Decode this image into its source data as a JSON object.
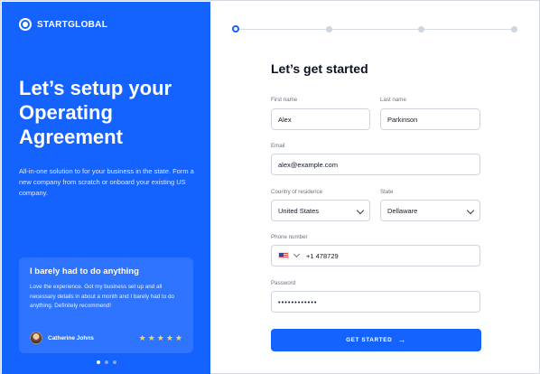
{
  "brand": {
    "name": "STARTGLOBAL",
    "logo_icon": "circle-logo-icon"
  },
  "left": {
    "headline": "Let’s setup your Operating Agreement",
    "subtext": "All-in-one solution to for your business in the state. Form a new company from scratch or onboard your existing US company.",
    "testimonial": {
      "title": "I barely had to do anything",
      "body": "Love the experience. Got my business set up and all necessary details in about a month and I barely had to do anything. Definitely recommend!",
      "person": "Catherine Johns",
      "rating": 5
    },
    "pagination": {
      "count": 3,
      "active_index": 0
    }
  },
  "stepper": {
    "steps": 4,
    "active_index": 0
  },
  "form": {
    "title": "Let’s get started",
    "first_name": {
      "label": "First name",
      "value": "Alex"
    },
    "last_name": {
      "label": "Last name",
      "value": "Parkinson"
    },
    "email": {
      "label": "Email",
      "value": "alex@example.com"
    },
    "country": {
      "label": "Country of residence",
      "value": "United States"
    },
    "state": {
      "label": "State",
      "value": "Dellaware"
    },
    "phone": {
      "label": "Phone number",
      "code": "+1 478729"
    },
    "password": {
      "label": "Password",
      "value": "••••••••••••"
    },
    "submit_label": "GET STARTED"
  },
  "colors": {
    "accent": "#1463ff",
    "panel": "#1463ff",
    "stars": "#ffd54a"
  }
}
